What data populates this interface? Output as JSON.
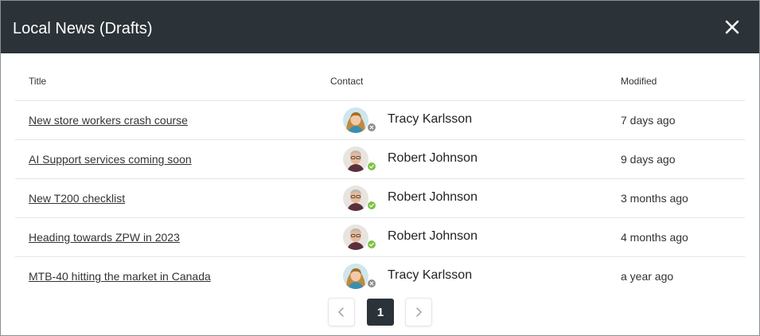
{
  "dialog": {
    "title": "Local News (Drafts)",
    "close_icon": "close-icon"
  },
  "table": {
    "columns": {
      "title": "Title",
      "contact": "Contact",
      "modified": "Modified"
    },
    "rows": [
      {
        "title": "New store workers crash course",
        "contact": "Tracy Karlsson",
        "status": "offline",
        "modified": "7 days ago"
      },
      {
        "title": "AI Support services coming soon",
        "contact": "Robert Johnson",
        "status": "available",
        "modified": "9 days ago"
      },
      {
        "title": "New T200 checklist",
        "contact": "Robert Johnson",
        "status": "available",
        "modified": "3 months ago"
      },
      {
        "title": "Heading towards ZPW in 2023",
        "contact": "Robert Johnson",
        "status": "available",
        "modified": "4 months ago"
      },
      {
        "title": "MTB-40 hitting the market in Canada",
        "contact": "Tracy Karlsson",
        "status": "offline",
        "modified": "a year ago"
      }
    ]
  },
  "pagination": {
    "current_page": "1",
    "prev_icon": "chevron-left-icon",
    "next_icon": "chevron-right-icon"
  },
  "colors": {
    "header_bg": "#2b3338",
    "available": "#7cc243",
    "offline": "#8c8f93"
  }
}
